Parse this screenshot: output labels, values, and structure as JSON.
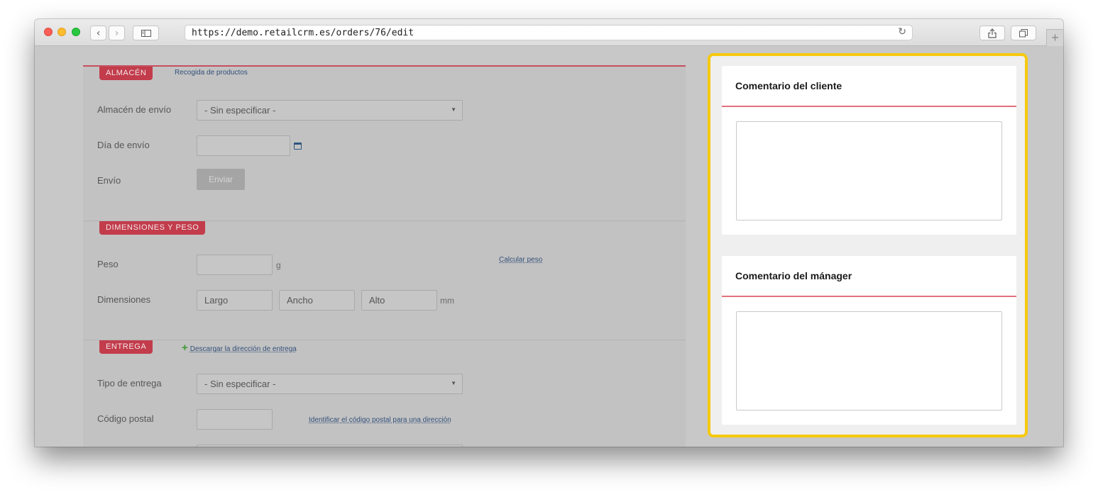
{
  "browser": {
    "url": "https://demo.retailcrm.es/orders/76/edit",
    "back_icon": "chevron-left",
    "forward_icon": "chevron-right",
    "sidebar_icon": "sidebar",
    "reload_icon": "reload",
    "share_icon": "share",
    "tabs_icon": "tabs",
    "new_tab_icon": "plus"
  },
  "warehouse": {
    "tag": "ALMACÉN",
    "link": "Recogida de productos",
    "fields": {
      "warehouse_label": "Almacén de envío",
      "warehouse_value": "- Sin especificar -",
      "ship_day_label": "Día de envío",
      "ship_day_value": "",
      "shipping_label": "Envío",
      "send_button": "Enviar"
    }
  },
  "dimensions": {
    "tag": "DIMENSIONES Y PESO",
    "weight_label": "Peso",
    "weight_unit": "g",
    "calc_weight_link": "Calcular peso",
    "dims_label": "Dimensiones",
    "length_placeholder": "Largo",
    "width_placeholder": "Ancho",
    "height_placeholder": "Alto",
    "dims_unit": "mm"
  },
  "delivery": {
    "tag": "ENTREGA",
    "download_link": "Descargar la dirección de entrega",
    "type_label": "Tipo de entrega",
    "type_value": "- Sin especificar -",
    "postal_label": "Código postal",
    "postal_link": "Identificar el código postal para una dirección"
  },
  "comments": {
    "client_title": "Comentario del cliente",
    "client_text": "",
    "manager_title": "Comentario del mánager",
    "manager_text": ""
  },
  "colors": {
    "highlight": "#f6c90e",
    "tag_red": "#c23c4b",
    "card_rule": "#e2707d"
  }
}
